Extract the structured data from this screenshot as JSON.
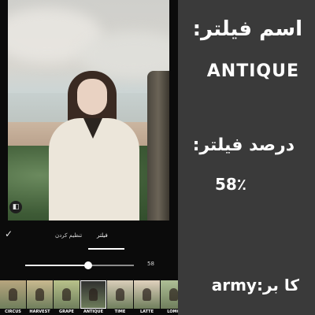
{
  "editor": {
    "compare_icon": "compare-icon",
    "check_icon": "check-icon",
    "tabs": [
      {
        "label": "تنظیم کردن",
        "active": false
      },
      {
        "label": "فیلتر",
        "active": true
      }
    ],
    "slider": {
      "value": 58,
      "value_label": "58"
    },
    "filters": [
      {
        "name": "CIRCUS",
        "color": "#b7a57e"
      },
      {
        "name": "HARVEST",
        "color": "#c9b98f"
      },
      {
        "name": "GRAPE",
        "color": "#b8c18a"
      },
      {
        "name": "ANTIQUE",
        "color": "#2e2e2e"
      },
      {
        "name": "TIME",
        "color": "#d9cdb9"
      },
      {
        "name": "LATTE",
        "color": "#e0d1bd"
      },
      {
        "name": "LOMO",
        "color": "#aebf96"
      }
    ],
    "selected_filter": "ANTIQUE"
  },
  "captions": {
    "filter_name_label": "اسم فیلتر:",
    "filter_name_value": "ANTIQUE",
    "filter_percent_label": "درصد فیلتر:",
    "filter_percent_value": "58٪",
    "user_credit": "army:کا بر"
  },
  "colors": {
    "panel_background": "#3a3a3a",
    "editor_background": "#0b0b0b",
    "text": "#ffffff"
  }
}
